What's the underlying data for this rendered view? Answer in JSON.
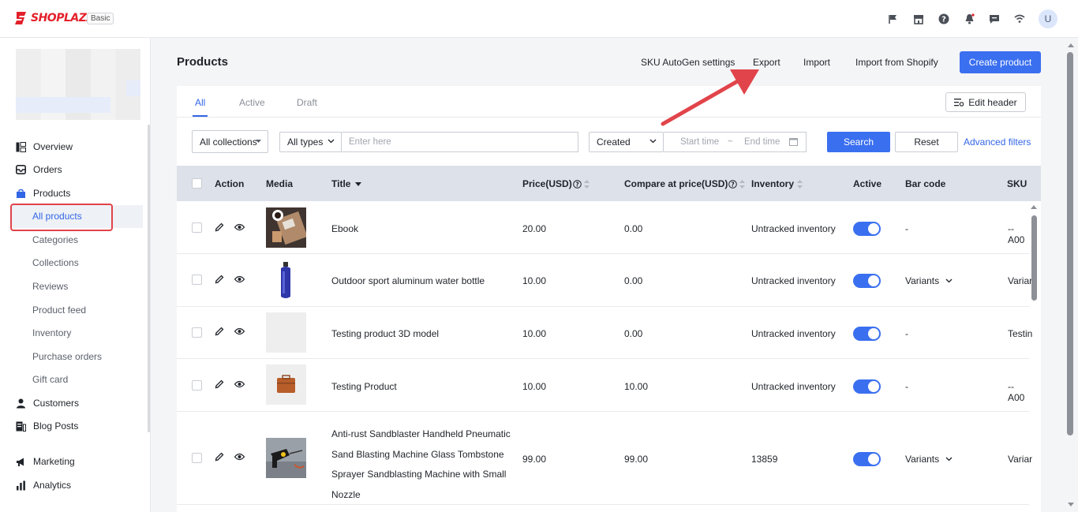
{
  "brand": {
    "name": "SHOPLAZZA",
    "plan": "Basic",
    "color": "#e3202a"
  },
  "topbar": {
    "icons": [
      "flag-icon",
      "store-icon",
      "help-icon",
      "bell-icon",
      "message-icon",
      "wifi-icon"
    ],
    "avatar": "U"
  },
  "sidebar": {
    "items": [
      {
        "label": "Overview",
        "icon": "overview-icon"
      },
      {
        "label": "Orders",
        "icon": "orders-icon"
      },
      {
        "label": "Products",
        "icon": "products-icon"
      },
      {
        "label": "Customers",
        "icon": "customers-icon"
      },
      {
        "label": "Blog Posts",
        "icon": "blog-icon"
      },
      {
        "label": "Marketing",
        "icon": "marketing-icon"
      },
      {
        "label": "Analytics",
        "icon": "analytics-icon"
      }
    ],
    "sub": [
      "All products",
      "Categories",
      "Collections",
      "Reviews",
      "Product feed",
      "Inventory",
      "Purchase orders",
      "Gift card"
    ]
  },
  "page": {
    "title": "Products",
    "actions": {
      "sku": "SKU AutoGen settings",
      "export": "Export",
      "import": "Import",
      "import_shopify": "Import from Shopify",
      "create": "Create product"
    }
  },
  "tabs": [
    "All",
    "Active",
    "Draft"
  ],
  "edit_header": "Edit header",
  "filters": {
    "collections": "All collections",
    "types": "All types",
    "search_placeholder": "Enter here",
    "date_field": "Created",
    "start": "Start time",
    "sep": "~",
    "end": "End time",
    "search": "Search",
    "reset": "Reset",
    "advanced": "Advanced filters"
  },
  "table": {
    "headers": {
      "action": "Action",
      "media": "Media",
      "title": "Title",
      "price": "Price(USD)",
      "compare": "Compare at price(USD)",
      "inventory": "Inventory",
      "active": "Active",
      "barcode": "Bar code",
      "sku": "SKU"
    },
    "rows": [
      {
        "title": "Ebook",
        "price": "20.00",
        "compare": "0.00",
        "inventory": "Untracked inventory",
        "barcode": "-",
        "sku": "--A00"
      },
      {
        "title": "Outdoor sport aluminum water bottle",
        "price": "10.00",
        "compare": "0.00",
        "inventory": "Untracked inventory",
        "barcode": "Variants",
        "sku": "Variar"
      },
      {
        "title": "Testing product 3D model",
        "price": "10.00",
        "compare": "0.00",
        "inventory": "Untracked inventory",
        "barcode": "-",
        "sku": "Testin"
      },
      {
        "title": "Testing Product",
        "price": "10.00",
        "compare": "10.00",
        "inventory": "Untracked inventory",
        "barcode": "-",
        "sku": "--A00"
      },
      {
        "title_lines": [
          "Anti-rust Sandblaster Handheld Pneumatic",
          "Sand Blasting Machine Glass Tombstone",
          "Sprayer Sandblasting Machine with Small",
          "Nozzle"
        ],
        "price": "99.00",
        "compare": "99.00",
        "inventory": "13859",
        "barcode": "Variants",
        "sku": "Variar"
      }
    ]
  }
}
